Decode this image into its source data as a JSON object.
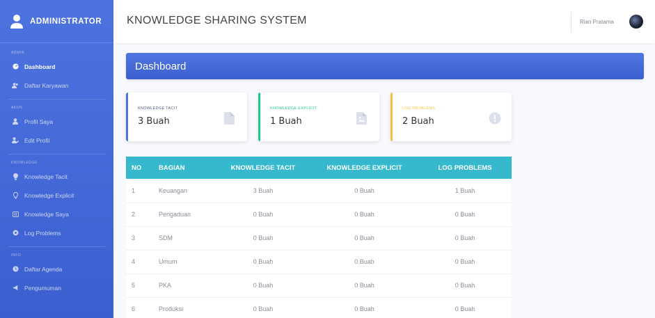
{
  "brand": {
    "title": "ADMINISTRATOR"
  },
  "sidebar": {
    "sections": [
      {
        "heading": "ADMIN",
        "items": [
          {
            "label": "Dashboard",
            "icon": "tachometer-icon",
            "active": true
          },
          {
            "label": "Daftar Karyawan",
            "icon": "users-icon"
          }
        ]
      },
      {
        "heading": "AKUN",
        "items": [
          {
            "label": "Profil Saya",
            "icon": "user-icon"
          },
          {
            "label": "Edit Profil",
            "icon": "user-edit-icon"
          }
        ]
      },
      {
        "heading": "KNOWLEDGE",
        "items": [
          {
            "label": "Knowledge Tacit",
            "icon": "lightbulb-icon"
          },
          {
            "label": "Knowledge Explicit",
            "icon": "lightbulb-outline-icon"
          },
          {
            "label": "Knowledge Saya",
            "icon": "book-icon"
          },
          {
            "label": "Log Problems",
            "icon": "cog-icon"
          }
        ]
      },
      {
        "heading": "INFO",
        "items": [
          {
            "label": "Daftar Agenda",
            "icon": "calendar-icon"
          },
          {
            "label": "Pengumuman",
            "icon": "bullhorn-icon"
          }
        ]
      }
    ]
  },
  "topbar": {
    "title": "KNOWLEDGE SHARING SYSTEM",
    "user_name": "Rian Pratama"
  },
  "dashboard": {
    "title": "Dashboard"
  },
  "cards": [
    {
      "label": "KNOWLEDGE TACIT",
      "value": "3 Buah",
      "color": "#4e73df",
      "label_color": "#4e5a7a",
      "icon": "file-icon"
    },
    {
      "label": "KNOWLEDGE EXPLICIT",
      "value": "1 Buah",
      "color": "#1cc88a",
      "label_color": "#1cc88a",
      "icon": "file-image-icon"
    },
    {
      "label": "LOG PROBLEMS",
      "value": "2 Buah",
      "color": "#f6c23e",
      "label_color": "#f6c23e",
      "icon": "exclamation-circle-icon"
    }
  ],
  "table": {
    "headers": [
      "NO",
      "BAGIAN",
      "KNOWLEDGE TACIT",
      "KNOWLEDGE EXPLICIT",
      "LOG PROBLEMS"
    ],
    "rows": [
      [
        "1",
        "Keuangan",
        "3 Buah",
        "0 Buah",
        "1 Buah"
      ],
      [
        "2",
        "Pengaduan",
        "0 Buah",
        "0 Buah",
        "0 Buah"
      ],
      [
        "3",
        "SDM",
        "0 Buah",
        "0 Buah",
        "0 Buah"
      ],
      [
        "4",
        "Umum",
        "0 Buah",
        "0 Buah",
        "0 Buah"
      ],
      [
        "5",
        "PKA",
        "0 Buah",
        "0 Buah",
        "0 Buah"
      ],
      [
        "6",
        "Produksi",
        "0 Buah",
        "0 Buah",
        "0 Buah"
      ]
    ]
  }
}
